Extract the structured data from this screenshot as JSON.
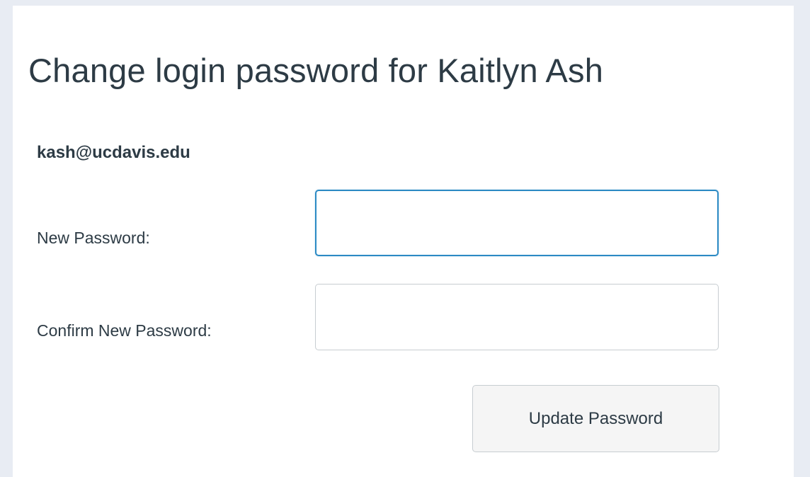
{
  "page": {
    "title": "Change login password for Kaitlyn Ash",
    "login_id": "kash@ucdavis.edu"
  },
  "form": {
    "new_password": {
      "label": "New Password:",
      "value": "",
      "focused": true
    },
    "confirm_password": {
      "label": "Confirm New Password:",
      "value": ""
    },
    "submit_label": "Update Password"
  },
  "colors": {
    "background": "#e8ecf3",
    "panel": "#ffffff",
    "text": "#2d3b45",
    "focus_border": "#2c8ac4",
    "input_border": "#c7cdd1",
    "button_bg": "#f5f5f5"
  }
}
